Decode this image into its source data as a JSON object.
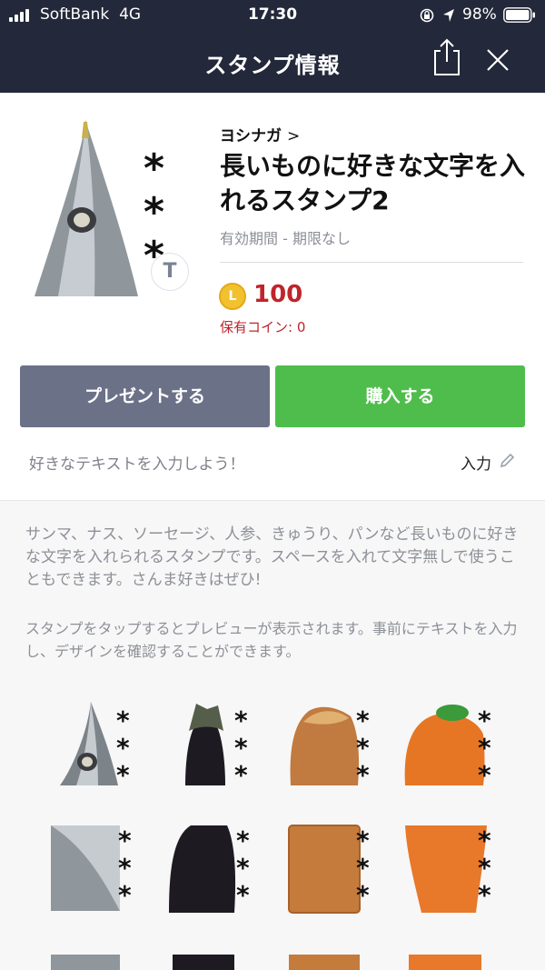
{
  "status_bar": {
    "carrier": "SoftBank",
    "network": "4G",
    "time": "17:30",
    "battery": "98%"
  },
  "nav": {
    "title": "スタンプ情報",
    "share_icon": "share-icon",
    "close_icon": "close-icon"
  },
  "sticker": {
    "author": "ヨシナガ",
    "author_chevron": ">",
    "title": "長いものに好きな文字を入れるスタンプ2",
    "validity": "有効期間 - 期限なし",
    "text_badge": "T",
    "price": "100",
    "coin_symbol": "L",
    "owned_coins": "保有コイン: 0"
  },
  "actions": {
    "gift_label": "プレゼントする",
    "buy_label": "購入する"
  },
  "custom_text": {
    "hint": "好きなテキストを入力しよう！",
    "input_label": "入力"
  },
  "description": "サンマ、ナス、ソーセージ、人参、きゅうり、パンなど長いものに好きな文字を入れられるスタンプです。スペースを入れて文字無しで使うこともできます。さんま好きはぜひ!",
  "tap_note": "スタンプをタップするとプレビューが表示されます。事前にテキストを入力し、デザインを確認することができます。",
  "stamps": [
    "saury-head",
    "eggplant-top",
    "sausage-end",
    "carrot-top",
    "saury-body",
    "eggplant-body",
    "sausage-body",
    "carrot-body"
  ],
  "colors": {
    "nav_bg": "#23283a",
    "gift_button": "#6b7187",
    "buy_button": "#4fbd4c",
    "price": "#c0242b",
    "coin": "#f2c12e"
  }
}
